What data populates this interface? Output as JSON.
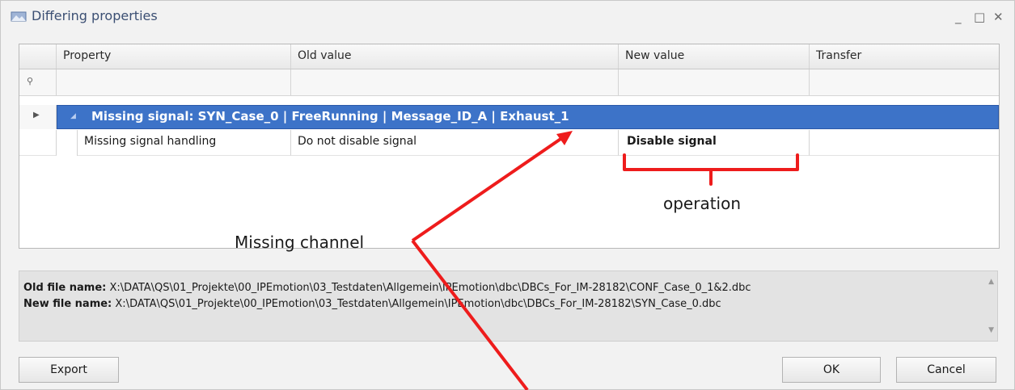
{
  "window": {
    "title": "Differing properties",
    "controls": [
      "_",
      "□",
      "✕"
    ]
  },
  "grid": {
    "columns": [
      "Property",
      "Old value",
      "New value",
      "Transfer"
    ],
    "filter_pin_icon": "pin-icon",
    "group": {
      "label": "Missing signal: SYN_Case_0 | FreeRunning | Message_ID_A | Exhaust_1",
      "color": "#3d73c8"
    },
    "rows": [
      {
        "property": "Missing signal handling",
        "old_value": "Do not disable signal",
        "new_value": "Disable signal",
        "transfer": true
      }
    ]
  },
  "info": {
    "old_label": "Old file name:",
    "old_path": " X:\\DATA\\QS\\01_Projekte\\00_IPEmotion\\03_Testdaten\\Allgemein\\IPEmotion\\dbc\\DBCs_For_IM-28182\\CONF_Case_0_1&2.dbc",
    "new_label": "New file name:",
    "new_path": " X:\\DATA\\QS\\01_Projekte\\00_IPEmotion\\03_Testdaten\\Allgemein\\IPEmotion\\dbc\\DBCs_For_IM-28182\\SYN_Case_0.dbc"
  },
  "buttons": {
    "export": "Export",
    "ok": "OK",
    "cancel": "Cancel"
  },
  "annotations": {
    "operation": "operation",
    "missing_channel": "Missing channel",
    "color": "#ee1c1c"
  }
}
